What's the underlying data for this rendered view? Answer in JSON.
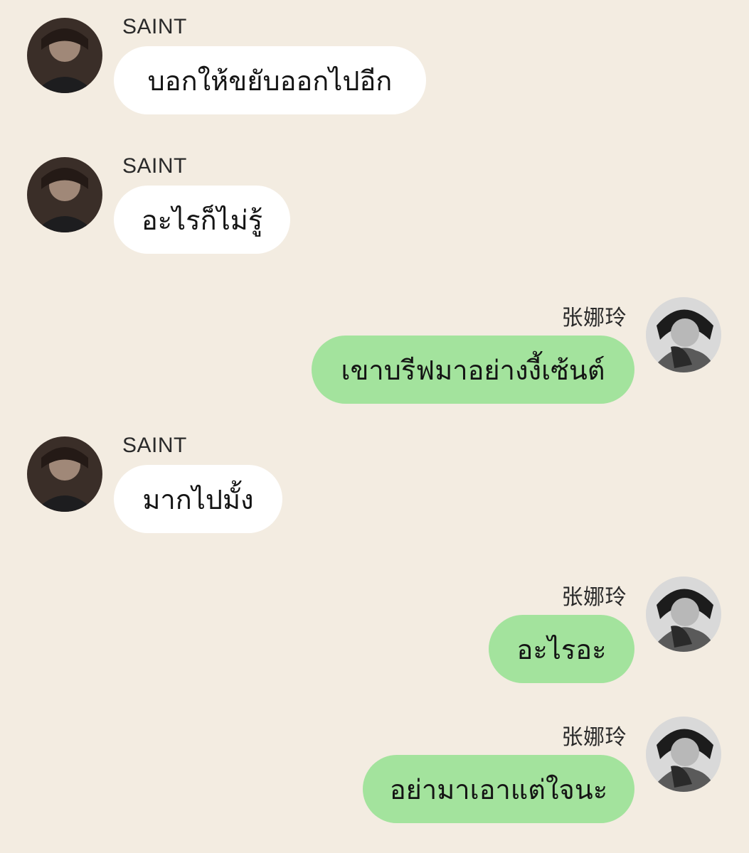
{
  "chat": {
    "messages": [
      {
        "sender": "SAINT",
        "side": "left",
        "text": "บอกให้ขยับออกไปอีก"
      },
      {
        "sender": "SAINT",
        "side": "left",
        "text": "อะไรก็ไม่รู้"
      },
      {
        "sender": "张娜玲",
        "side": "right",
        "text": "เขาบรีฟมาอย่างงี้เซ้นต์"
      },
      {
        "sender": "SAINT",
        "side": "left",
        "text": "มากไปมั้ง"
      },
      {
        "sender": "张娜玲",
        "side": "right",
        "text": "อะไรอะ"
      },
      {
        "sender": "张娜玲",
        "side": "right",
        "text": "อย่ามาเอาแต่ใจนะ"
      }
    ]
  },
  "colors": {
    "background": "#f3ece1",
    "incoming_bubble": "#ffffff",
    "outgoing_bubble": "#a3e39d"
  }
}
